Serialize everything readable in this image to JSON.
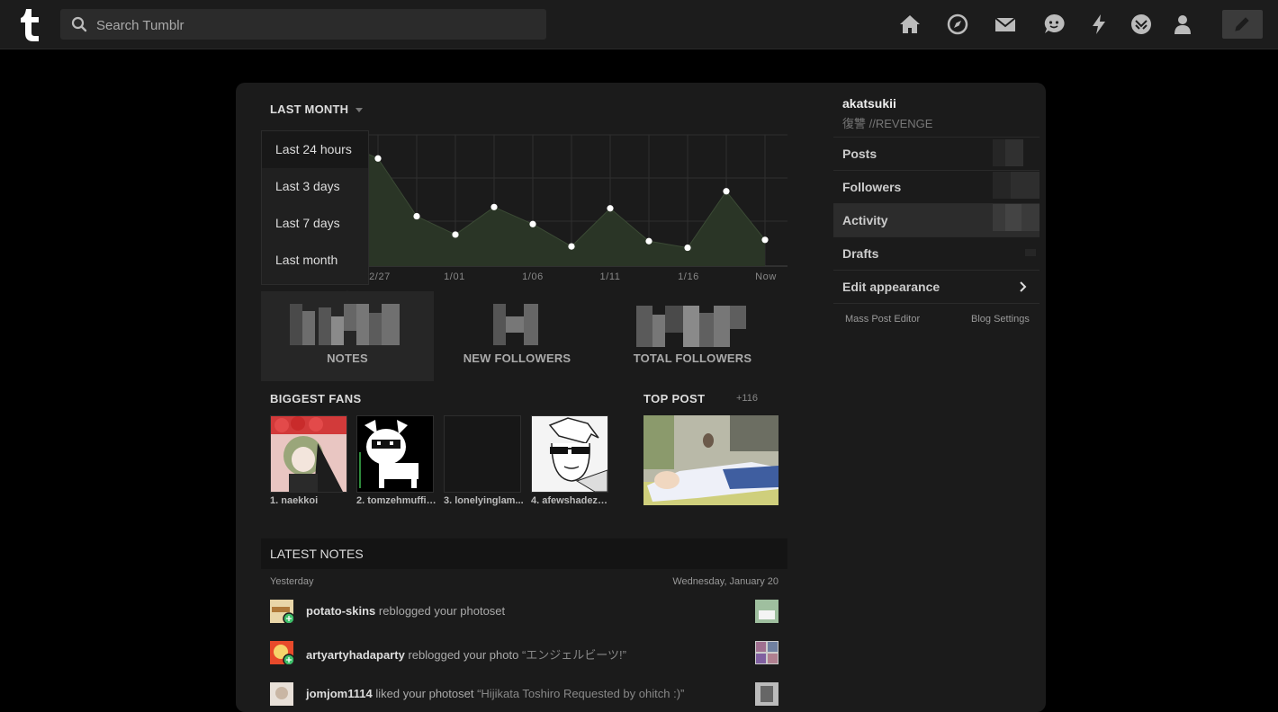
{
  "topbar": {
    "logo_icon": "tumblr-logo",
    "search_placeholder": "Search Tumblr",
    "nav_icons": [
      "home-icon",
      "explore-icon",
      "inbox-icon",
      "messaging-icon",
      "activity-icon",
      "patio-icon",
      "account-icon",
      "compose-icon"
    ]
  },
  "activity": {
    "period_label": "LAST MONTH",
    "dropdown": [
      "Last 24 hours",
      "Last 3 days",
      "Last 7 days",
      "Last month"
    ],
    "x_ticks": [
      "2/27",
      "1/01",
      "1/06",
      "1/11",
      "1/16",
      "Now"
    ],
    "stats": [
      {
        "label": "NOTES"
      },
      {
        "label": "NEW FOLLOWERS"
      },
      {
        "label": "TOTAL FOLLOWERS"
      }
    ]
  },
  "chart_data": {
    "type": "area",
    "x_ticks": [
      "2/27",
      "1/01",
      "1/06",
      "1/11",
      "1/16",
      "Now"
    ],
    "values_relative": [
      0.82,
      0.38,
      0.24,
      0.45,
      0.32,
      0.15,
      0.44,
      0.19,
      0.14,
      0.57,
      0.2
    ],
    "note": "y-axis unlabeled; relative heights only"
  },
  "fans": {
    "title": "BIGGEST FANS",
    "items": [
      {
        "name": "1. naekkoi"
      },
      {
        "name": "2. tomzehmuffin..."
      },
      {
        "name": "3. lonelyinglam..."
      },
      {
        "name": "4. afewshadezof..."
      }
    ]
  },
  "top_post": {
    "title": "TOP POST",
    "count": "+116"
  },
  "latest": {
    "title": "LATEST NOTES",
    "date_left": "Yesterday",
    "date_right": "Wednesday, January 20",
    "notes": [
      {
        "user": "potato-skins",
        "action": "reblogged your photoset",
        "quote": ""
      },
      {
        "user": "artyartyhadaparty",
        "action": "reblogged your photo",
        "quote": "“エンジェルビーツ!”"
      },
      {
        "user": "jomjom1114",
        "action": "liked your photoset",
        "quote": "“Hijikata Toshiro Requested by ohitch :)”"
      }
    ]
  },
  "sidebar": {
    "blog_name": "akatsukii",
    "blog_title": "復讐 //REVENGE",
    "items": [
      "Posts",
      "Followers",
      "Activity",
      "Drafts",
      "Edit appearance"
    ],
    "mass_post_editor": "Mass Post Editor",
    "blog_settings": "Blog Settings"
  },
  "colors": {
    "background": "#000000",
    "panel": "#1b1b1b",
    "chart_fill": "#2a3526",
    "accent": "#ffffff"
  }
}
